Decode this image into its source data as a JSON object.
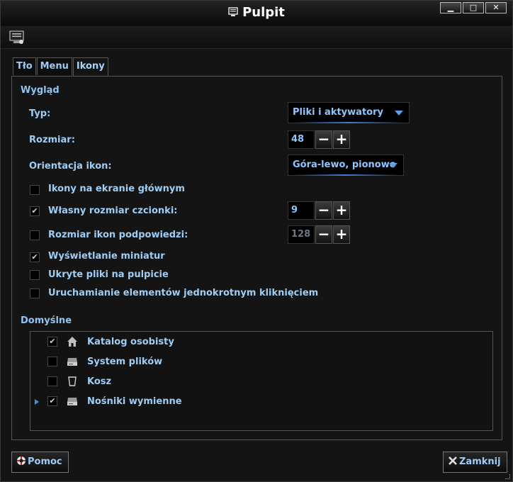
{
  "window": {
    "title": "Pulpit",
    "controls": [
      "▁",
      "□",
      "✕"
    ]
  },
  "tabs": [
    {
      "label": "Tło",
      "active": false
    },
    {
      "label": "Menu",
      "active": false
    },
    {
      "label": "Ikony",
      "active": true
    }
  ],
  "appearance": {
    "heading": "Wygląd",
    "type_label": "Typ:",
    "type_value": "Pliki i aktywatory",
    "size_label": "Rozmiar:",
    "size_value": "48",
    "orientation_label": "Orientacja ikon:",
    "orientation_value": "Góra-lewo, pionowo",
    "options": [
      {
        "label": "Ikony na ekranie głównym",
        "checked": false
      },
      {
        "label": "Własny rozmiar czcionki:",
        "checked": true,
        "value": "9"
      },
      {
        "label": "Rozmiar ikon podpowiedzi:",
        "checked": false,
        "value": "128"
      },
      {
        "label": "Wyświetlanie miniatur",
        "checked": true
      },
      {
        "label": "Ukryte pliki na pulpicie",
        "checked": false
      },
      {
        "label": "Uruchamianie elementów jednokrotnym kliknięciem",
        "checked": false
      }
    ]
  },
  "defaults": {
    "heading": "Domyślne",
    "items": [
      {
        "label": "Katalog osobisty",
        "checked": true,
        "icon": "home-icon"
      },
      {
        "label": "System plików",
        "checked": false,
        "icon": "drive-icon"
      },
      {
        "label": "Kosz",
        "checked": false,
        "icon": "trash-icon"
      },
      {
        "label": "Nośniki wymienne",
        "checked": true,
        "icon": "drive-icon",
        "expandable": true
      }
    ]
  },
  "buttons": {
    "help": "Pomoc",
    "close": "Zamknij"
  },
  "spinner": {
    "minus": "−",
    "plus": "+"
  },
  "check_mark": "✔"
}
